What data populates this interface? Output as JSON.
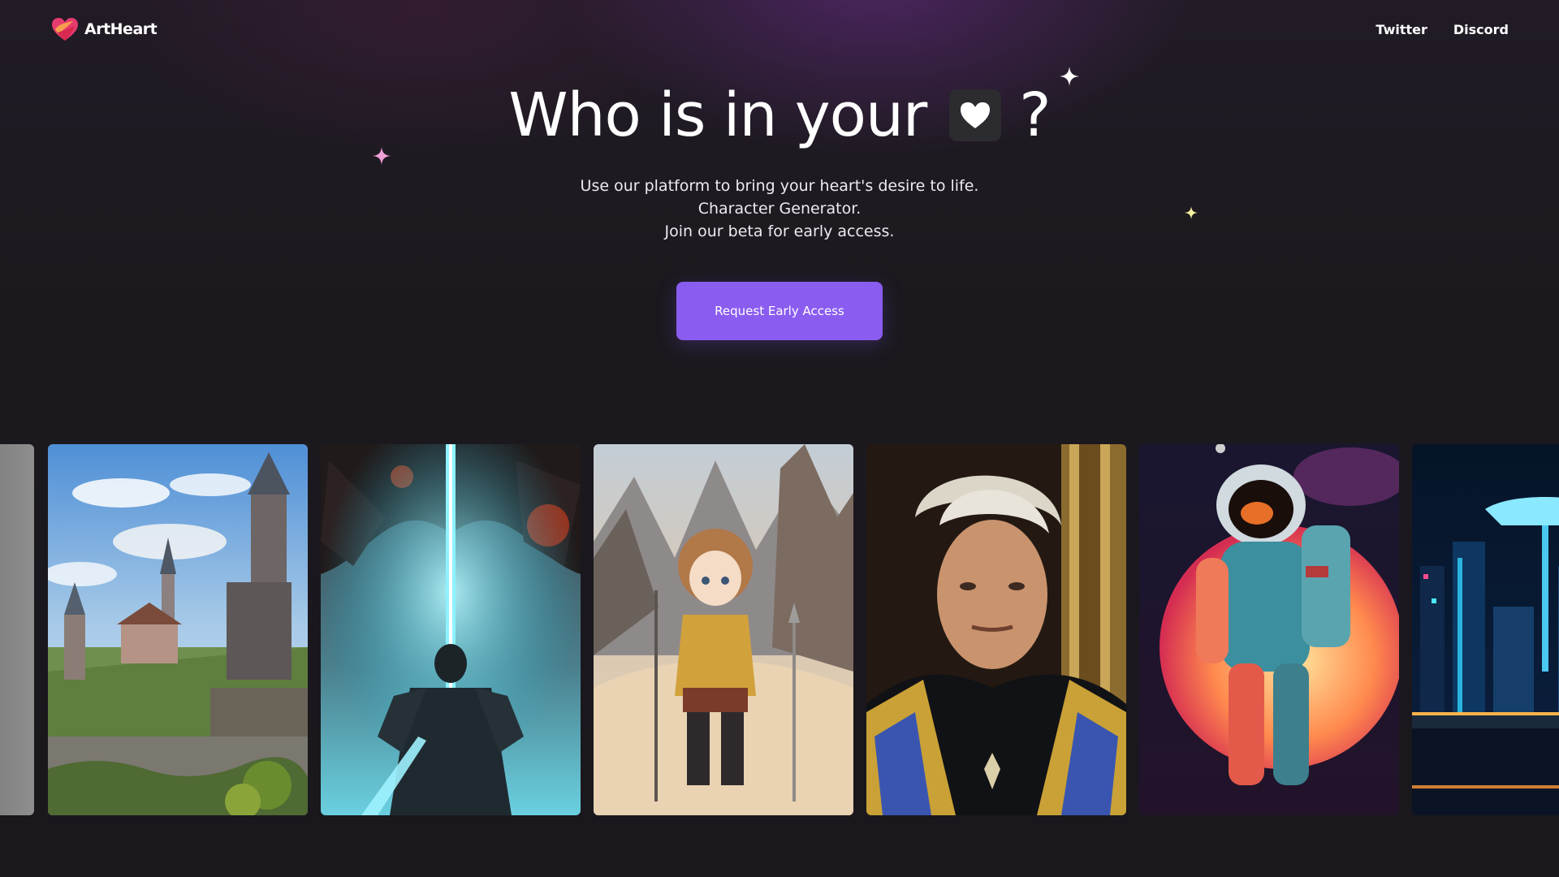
{
  "brand": {
    "name": "ArtHeart",
    "colors": {
      "logo_primary": "#e63b6f",
      "logo_secondary": "#f7a94a"
    }
  },
  "nav": {
    "links": [
      {
        "label": "Twitter",
        "icon": "twitter-link"
      },
      {
        "label": "Discord",
        "icon": "discord-link"
      }
    ]
  },
  "hero": {
    "title_text": "Who is in your",
    "title_icon": "heart-icon",
    "title_suffix": "?",
    "subtitle_lines": [
      "Use our platform to bring your heart's desire to life.",
      "Character Generator.",
      "Join our beta for early access."
    ],
    "cta_label": "Request Early Access",
    "accent": "#8a5cf0"
  },
  "gallery": {
    "items": [
      {
        "name": "partial-gray-card"
      },
      {
        "name": "fantasy-castle-town"
      },
      {
        "name": "skeleton-knight-blue-beam"
      },
      {
        "name": "anime-girl-adventurer-mountains"
      },
      {
        "name": "silver-haired-man-gold-robe"
      },
      {
        "name": "astronaut-red-moon"
      },
      {
        "name": "neon-city-bridge"
      }
    ]
  }
}
